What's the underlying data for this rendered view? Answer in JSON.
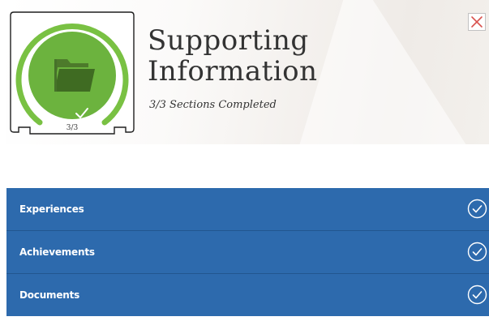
{
  "header": {
    "title_line1": "Supporting",
    "title_line2": "Information",
    "subtitle": "3/3 Sections Completed",
    "badge_count": "3/3",
    "badge_progress": 1.0,
    "badge_icon": "folder-icon",
    "badge_status_icon": "check-icon",
    "close_icon": "close-icon"
  },
  "sections": [
    {
      "label": "Experiences",
      "status_icon": "check-circle-icon",
      "completed": true
    },
    {
      "label": "Achievements",
      "status_icon": "check-circle-icon",
      "completed": true
    },
    {
      "label": "Documents",
      "status_icon": "check-circle-icon",
      "completed": true
    }
  ],
  "colors": {
    "section_bg": "#2d6aad",
    "badge_green": "#6cb33e",
    "badge_ring": "#79c143",
    "close_red": "#d9534f",
    "text_dark": "#333333"
  }
}
